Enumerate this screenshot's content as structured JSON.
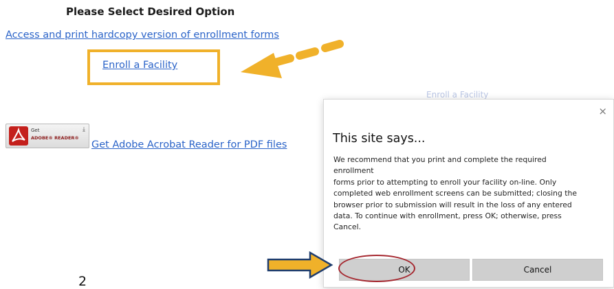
{
  "page": {
    "heading": "Please Select Desired Option",
    "link_hardcopy": "Access and print hardcopy version of enrollment forms",
    "link_enroll": "Enroll a Facility",
    "link_adobe": "Get Adobe Acrobat Reader for PDF files",
    "adobe_badge": {
      "get": "Get",
      "reader": "ADOBE® READER®"
    },
    "faded_text": "Enroll a Facility",
    "small_digit": "2"
  },
  "dialog": {
    "title": "This site says...",
    "close_glyph": "×",
    "message_lines": [
      "We recommend that you print and complete the required",
      "enrollment",
      "forms prior to attempting to enroll your facility on-line.  Only",
      "completed web enrollment screens can be submitted; closing the",
      "browser prior to submission will result in the loss of any entered",
      "data.  To continue with enrollment, press OK; otherwise, press",
      "Cancel."
    ],
    "ok_label": "OK",
    "cancel_label": "Cancel"
  },
  "annotations": {
    "color": "#f0b12a",
    "ring_color": "#a5262e",
    "icons": [
      "dashed-arrow-icon",
      "block-arrow-icon",
      "close-icon",
      "adobe-logo-icon"
    ]
  }
}
